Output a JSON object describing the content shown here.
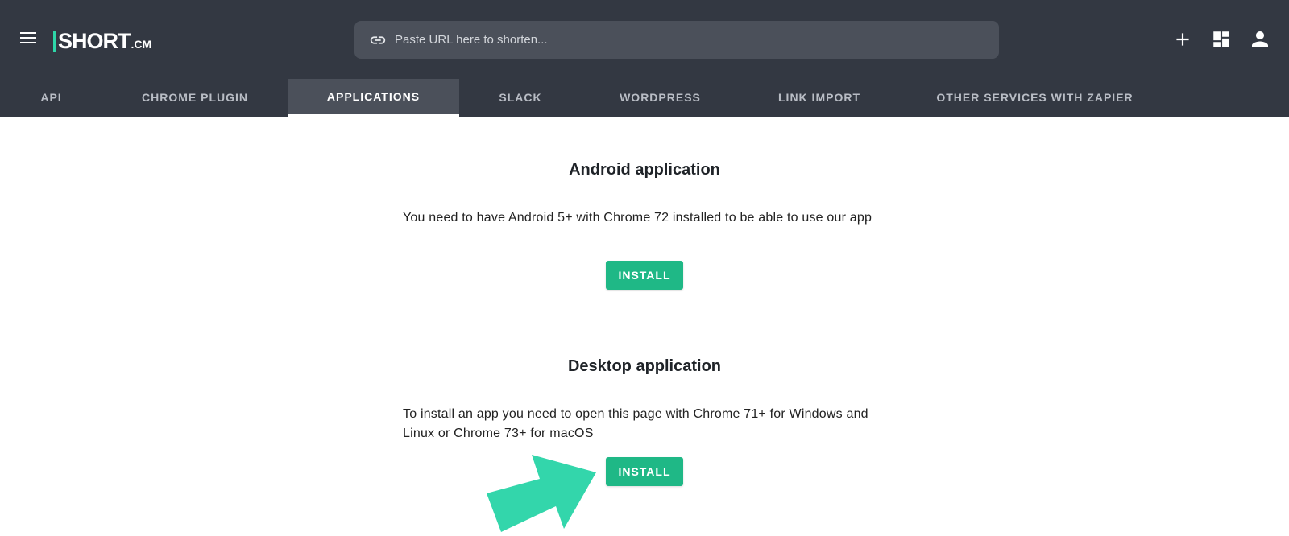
{
  "header": {
    "menu_icon": "hamburger-menu-icon",
    "logo": {
      "main": "SHORT",
      "suffix": ".CM"
    },
    "search": {
      "placeholder": "Paste URL here to shorten...",
      "value": "",
      "icon": "link-icon"
    },
    "actions": [
      {
        "name": "add-icon"
      },
      {
        "name": "dashboard-icon"
      },
      {
        "name": "account-icon"
      }
    ]
  },
  "tabs": [
    {
      "label": "API",
      "active": false
    },
    {
      "label": "CHROME PLUGIN",
      "active": false
    },
    {
      "label": "APPLICATIONS",
      "active": true
    },
    {
      "label": "SLACK",
      "active": false
    },
    {
      "label": "WORDPRESS",
      "active": false
    },
    {
      "label": "LINK IMPORT",
      "active": false
    },
    {
      "label": "OTHER SERVICES WITH ZAPIER",
      "active": false
    }
  ],
  "sections": [
    {
      "title": "Android application",
      "text": "You need to have Android 5+ with Chrome 72 installed to be able to use our app",
      "button": "INSTALL"
    },
    {
      "title": "Desktop application",
      "text": "To install an app you need to open this page with Chrome 71+ for Windows and Linux or Chrome 73+ for macOS",
      "button": "INSTALL"
    }
  ],
  "colors": {
    "header_bg": "#333842",
    "search_bg": "#4b505a",
    "accent": "#1fb886",
    "arrow": "#33d6ab"
  }
}
